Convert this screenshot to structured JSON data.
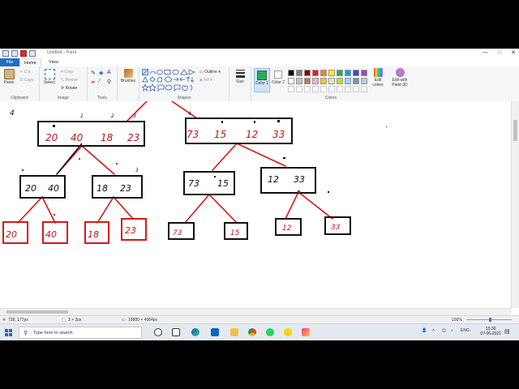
{
  "window": {
    "title": "Untitled - Paint",
    "controls": [
      "—",
      "□",
      "✕"
    ]
  },
  "tabs": {
    "file": "File",
    "home": "Home",
    "view": "View"
  },
  "ribbon": {
    "clipboard": {
      "label": "Clipboard",
      "paste": "Paste",
      "cut": "Cut",
      "copy": "Copy"
    },
    "image": {
      "label": "Image",
      "select": "Select",
      "crop": "Crop",
      "resize": "Resize",
      "rotate": "Rotate"
    },
    "tools": {
      "label": "Tools"
    },
    "brushes": {
      "label": "Brushes"
    },
    "shapes": {
      "label": "Shapes",
      "outline": "Outline",
      "fill": "Fill"
    },
    "size": {
      "label": "Size"
    },
    "colors": {
      "label": "Colors",
      "color1": "Color 1",
      "color2": "Color 2",
      "color1_value": "#22b14c",
      "color2_value": "#ffffff",
      "edit_colors": "Edit colors",
      "paint3d": "Edit with Paint 3D",
      "palette": [
        "#000000",
        "#7f7f7f",
        "#880015",
        "#ed1c24",
        "#ff7f27",
        "#fff200",
        "#22b14c",
        "#00a2e8",
        "#3f48cc",
        "#a349a4",
        "#ffffff",
        "#c3c3c3",
        "#b97a57",
        "#ffaec9",
        "#ffc90e",
        "#efe4b0",
        "#b5e61d",
        "#99d9ea",
        "#7092be",
        "#c8bfe7"
      ]
    }
  },
  "drawing": {
    "top_left_box": [
      "20",
      "40",
      "18",
      "23"
    ],
    "top_right_box": [
      "73",
      "15",
      "12",
      "33"
    ],
    "mid_boxes": [
      {
        "a": "20",
        "b": "40"
      },
      {
        "a": "18",
        "b": "23"
      },
      {
        "a": "73",
        "b": "15"
      },
      {
        "a": "12",
        "b": "33"
      }
    ],
    "leaves": [
      "20",
      "40",
      "18",
      "23",
      "73",
      "15",
      "12",
      "33"
    ],
    "index_marks": [
      "1",
      "2",
      "3",
      "4"
    ]
  },
  "status": {
    "cursor": "728, 177px",
    "selection": "3 × 2px",
    "canvas_size": "10880 × 4984px",
    "zoom": "100%"
  },
  "taskbar": {
    "search_placeholder": "Type here to search",
    "lang": "ENG",
    "time": "15:30",
    "date": "07-06-2021"
  }
}
